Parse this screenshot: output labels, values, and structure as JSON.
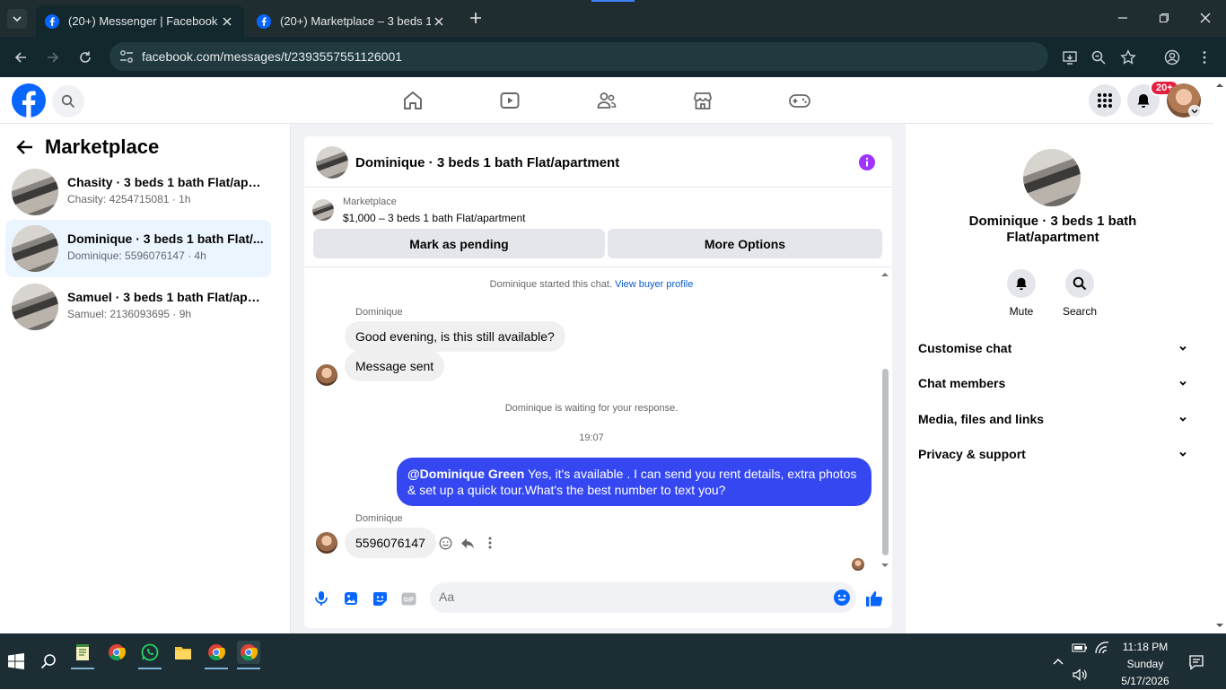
{
  "browser": {
    "tabs": [
      {
        "title": "(20+) Messenger | Facebook",
        "active": true
      },
      {
        "title": "(20+) Marketplace – 3 beds 1 b",
        "active": false
      }
    ],
    "url": "facebook.com/messages/t/2393557551126001"
  },
  "fb_header": {
    "notification_badge": "20+"
  },
  "left_panel": {
    "title": "Marketplace",
    "conversations": [
      {
        "name": "Chasity · 3 beds 1 bath Flat/apar...",
        "preview": "Chasity: 4254715081 · 1h",
        "selected": false
      },
      {
        "name": "Dominique · 3 beds 1 bath Flat/...",
        "preview": "Dominique: 5596076147 · 4h",
        "selected": true
      },
      {
        "name": "Samuel · 3 beds 1 bath Flat/apar...",
        "preview": "Samuel: 2136093695 · 9h",
        "selected": false
      }
    ]
  },
  "chat": {
    "title": "Dominique · 3 beds 1 bath Flat/apartment",
    "marketplace_label": "Marketplace",
    "listing": "$1,000 – 3 beds 1 bath Flat/apartment",
    "btn_pending": "Mark as pending",
    "btn_more": "More Options",
    "started_text": "Dominique started this chat.",
    "view_profile": "View buyer profile",
    "sender1": "Dominique",
    "msg1": "Good evening, is this still available?",
    "msg2": "Message sent",
    "waiting": "Dominique is waiting for your response.",
    "time": "19:07",
    "my_mention": "@Dominique Green",
    "my_msg": " Yes, it's available .  I can send you rent details, extra photos & set up a quick tour.What's the best number to text you?",
    "sender2": "Dominique",
    "msg3": "5596076147",
    "composer_placeholder": "Aa"
  },
  "right_panel": {
    "name": "Dominique · 3 beds 1 bath Flat/apartment",
    "mute": "Mute",
    "search": "Search",
    "sections": [
      "Customise chat",
      "Chat members",
      "Media, files and links",
      "Privacy & support"
    ]
  },
  "taskbar": {
    "time": "11:18 PM",
    "day": "Sunday",
    "date": "5/17/2026"
  },
  "colors": {
    "accent": "#3547f1",
    "fb_blue": "#0866ff",
    "info_purple": "#a033ff"
  }
}
